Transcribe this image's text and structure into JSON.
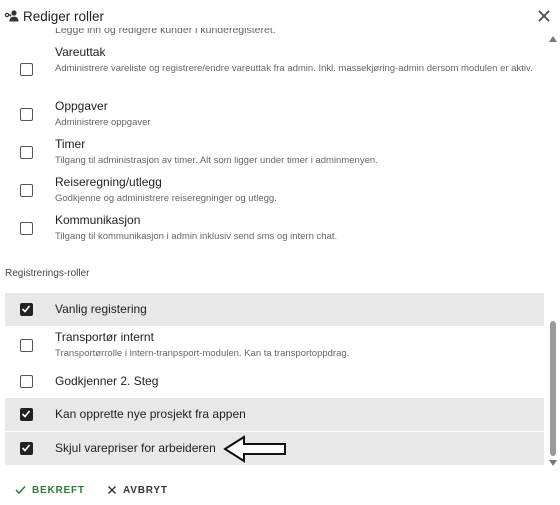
{
  "header": {
    "title": "Rediger roller",
    "title_icon": "user-key-icon",
    "close_icon": "close-icon"
  },
  "cut_row_text": "Legge inn og redigere kunder i kunderegisteret.",
  "admin_roles": [
    {
      "label": "Vareuttak",
      "description": "Administrere vareliste og registrere/endre vareuttak fra admin. Inkl. massekjøring-admin dersom modulen er aktiv.",
      "checked": false
    },
    {
      "label": "Oppgaver",
      "description": "Administrere oppgaver",
      "checked": false
    },
    {
      "label": "Timer",
      "description": "Tilgang til administrasjon av timer. Alt som ligger under timer i adminmenyen.",
      "checked": false
    },
    {
      "label": "Reiseregning/utlegg",
      "description": "Godkjenne og administrere reiseregninger og utlegg.",
      "checked": false
    },
    {
      "label": "Kommunikasjon",
      "description": "Tilgang til kommunikasjon i admin inklusiv send sms og intern chat.",
      "checked": false
    }
  ],
  "registration_section": {
    "title": "Registrerings-roller",
    "roles": [
      {
        "label": "Vanlig registering",
        "description": "",
        "checked": true
      },
      {
        "label": "Transportør internt",
        "description": "Transportørrolle i intern-tranpsport-modulen. Kan ta transportoppdrag.",
        "checked": false
      },
      {
        "label": "Godkjenner 2. Steg",
        "description": "",
        "checked": false
      },
      {
        "label": "Kan opprette nye prosjekt fra appen",
        "description": "",
        "checked": true
      },
      {
        "label": "Skjul varepriser for arbeideren",
        "description": "",
        "checked": true
      }
    ]
  },
  "footer": {
    "confirm_label": "BEKREFT",
    "cancel_label": "AVBRYT"
  },
  "colors": {
    "confirm": "#2e7d32",
    "checked_row_bg": "#e8e8e8",
    "checkbox_checked": "#222222"
  }
}
